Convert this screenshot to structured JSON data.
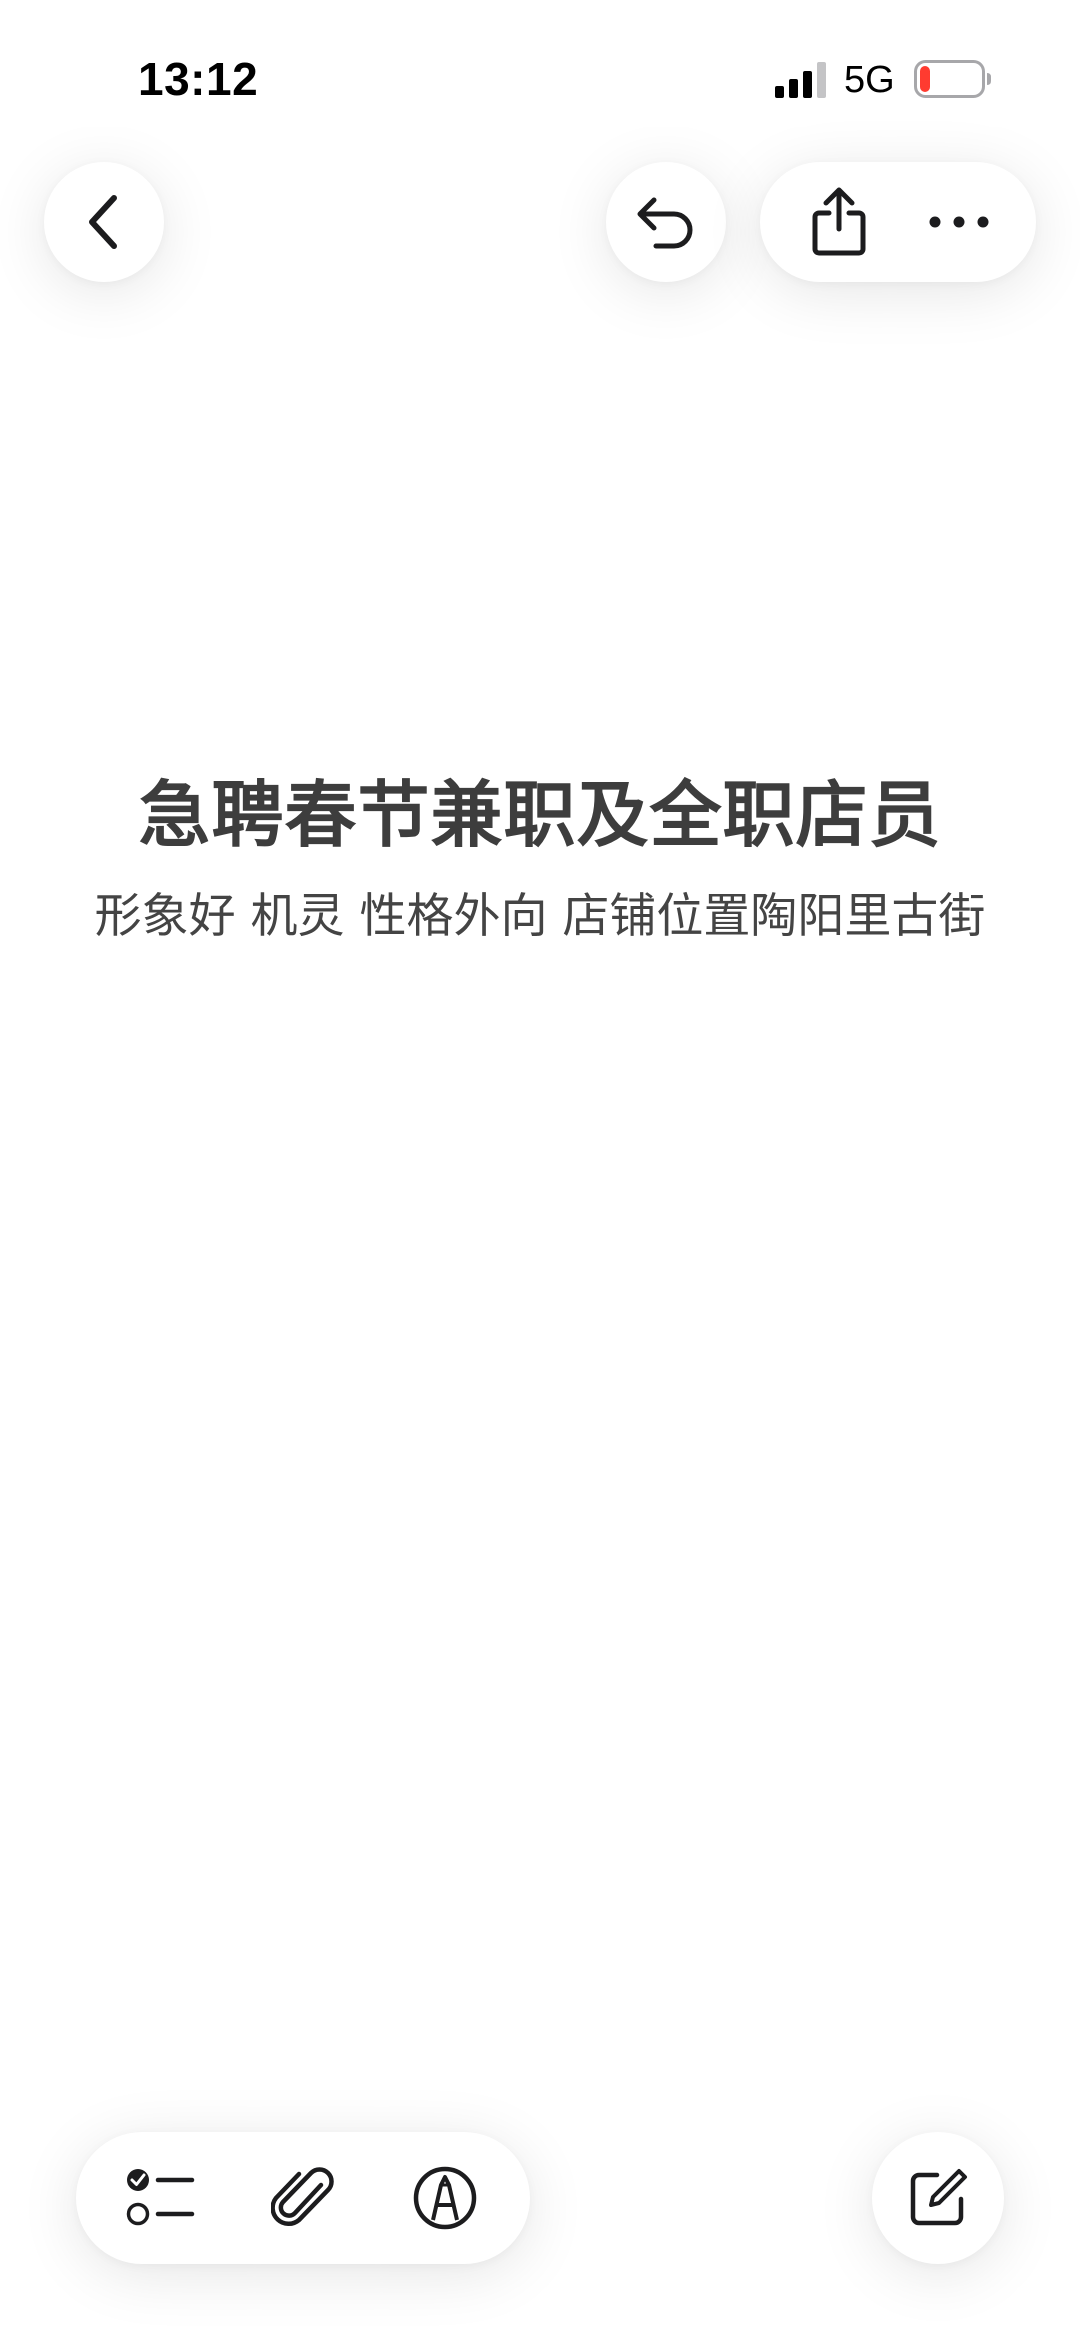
{
  "status_bar": {
    "time": "13:12",
    "network": "5G",
    "battery_level": 0.1,
    "battery_color": "#ff3b30"
  },
  "toolbar": {
    "back_icon": "chevron-left-icon",
    "undo_icon": "undo-icon",
    "share_icon": "share-icon",
    "more_icon": "ellipsis-icon"
  },
  "note": {
    "title": "急聘春节兼职及全职店员",
    "body": "形象好 机灵 性格外向 店铺位置陶阳里古街"
  },
  "bottom_toolbar": {
    "checklist_icon": "checklist-icon",
    "attach_icon": "paperclip-icon",
    "markup_icon": "pen-tip-icon",
    "compose_icon": "compose-icon"
  },
  "colors": {
    "background": "#ffffff",
    "text": "#3d3d3d",
    "icon": "#1c1c1e"
  }
}
